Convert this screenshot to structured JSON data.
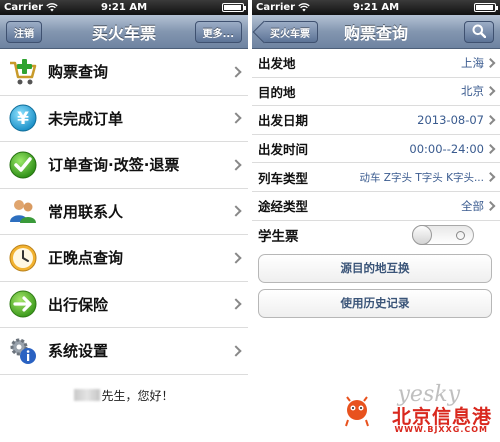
{
  "status": {
    "carrier": "Carrier",
    "time": "9:21 AM"
  },
  "left": {
    "nav": {
      "title": "买火车票",
      "left_btn": "注销",
      "right_btn": "更多..."
    },
    "menu": [
      {
        "label": "购票查询",
        "icon": "cart-plus-icon"
      },
      {
        "label": "未完成订单",
        "icon": "yen-coin-icon"
      },
      {
        "label": "订单查询·改签·退票",
        "icon": "checkmark-icon"
      },
      {
        "label": "常用联系人",
        "icon": "contacts-icon"
      },
      {
        "label": "正晚点查询",
        "icon": "clock-icon"
      },
      {
        "label": "出行保险",
        "icon": "arrow-right-circle-icon"
      },
      {
        "label": "系统设置",
        "icon": "gears-info-icon"
      }
    ],
    "greeting": "先生，您好！"
  },
  "right": {
    "nav": {
      "title": "购票查询",
      "back_btn": "买火车票"
    },
    "rows": [
      {
        "label": "出发地",
        "value": "上海"
      },
      {
        "label": "目的地",
        "value": "北京"
      },
      {
        "label": "出发日期",
        "value": "2013-08-07"
      },
      {
        "label": "出发时间",
        "value": "00:00--24:00"
      },
      {
        "label": "列车类型",
        "value": "动车 Z字头 T字头 K字头..."
      },
      {
        "label": "途经类型",
        "value": "全部"
      }
    ],
    "student": {
      "label": "学生票"
    },
    "buttons": {
      "swap": "源目的地互换",
      "history": "使用历史记录"
    }
  },
  "watermark": {
    "brand": "yesky",
    "name": "北京信息港",
    "url": "WWW.BJXXG.COM"
  },
  "colors": {
    "nav_top": "#b4c2d4",
    "nav_bottom": "#6e83a1",
    "value_blue": "#3a5b8f",
    "watermark_red": "#d9281e"
  }
}
